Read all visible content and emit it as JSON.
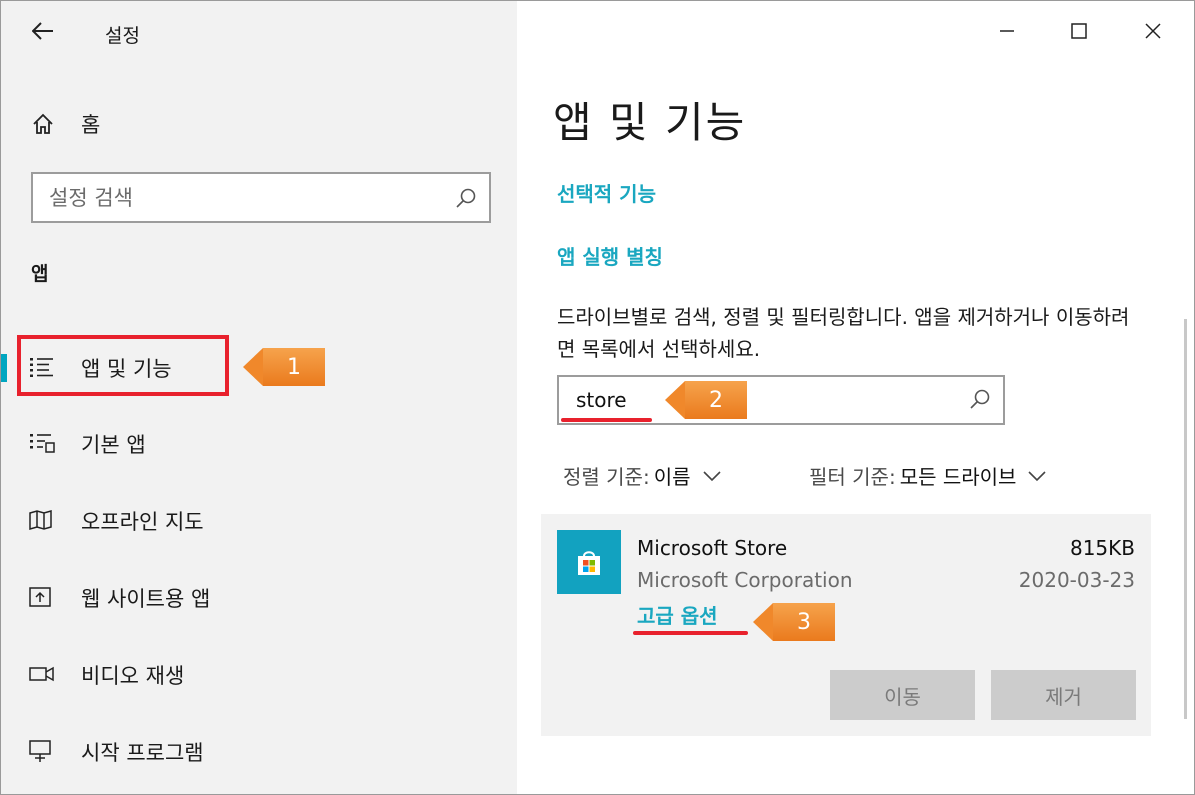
{
  "window": {
    "title": "설정",
    "controls": {
      "minimize": "minimize",
      "maximize": "maximize",
      "close": "close"
    }
  },
  "sidebar": {
    "home_label": "홈",
    "search_placeholder": "설정 검색",
    "section_label": "앱",
    "items": [
      {
        "label": "앱 및 기능",
        "icon": "list-icon",
        "selected": true
      },
      {
        "label": "기본 앱",
        "icon": "default-apps-icon",
        "selected": false
      },
      {
        "label": "오프라인 지도",
        "icon": "map-icon",
        "selected": false
      },
      {
        "label": "웹 사이트용 앱",
        "icon": "web-app-icon",
        "selected": false
      },
      {
        "label": "비디오 재생",
        "icon": "video-icon",
        "selected": false
      },
      {
        "label": "시작 프로그램",
        "icon": "startup-icon",
        "selected": false
      }
    ]
  },
  "main": {
    "page_title": "앱 및 기능",
    "links": {
      "optional_features": "선택적 기능",
      "app_execution_alias": "앱 실행 별칭"
    },
    "description": "드라이브별로 검색, 정렬 및 필터링합니다. 앱을 제거하거나 이동하려면 목록에서 선택하세요.",
    "filter_value": "store",
    "sort": {
      "label": "정렬 기준:",
      "value": "이름"
    },
    "filter": {
      "label": "필터 기준:",
      "value": "모든 드라이브"
    },
    "app": {
      "name": "Microsoft Store",
      "publisher": "Microsoft Corporation",
      "size": "815KB",
      "date": "2020-03-23",
      "advanced_options": "고급 옵션",
      "move_button": "이동",
      "uninstall_button": "제거"
    }
  },
  "annotations": {
    "callout_1": "1",
    "callout_2": "2",
    "callout_3": "3"
  },
  "colors": {
    "accent": "#1aa7c0",
    "highlight": "#e8212d",
    "callout": "#f0882b",
    "sidebar_bg": "#f2f2f2"
  }
}
